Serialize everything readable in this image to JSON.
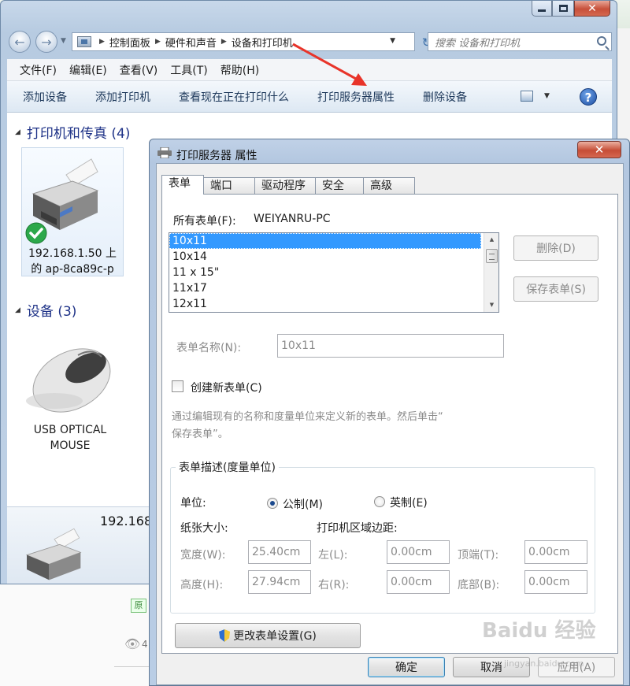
{
  "explorer": {
    "crumbs": [
      "控制面板",
      "硬件和声音",
      "设备和打印机"
    ],
    "search_placeholder": "搜索 设备和打印机",
    "menu": [
      "文件(F)",
      "编辑(E)",
      "查看(V)",
      "工具(T)",
      "帮助(H)"
    ],
    "commands": [
      "添加设备",
      "添加打印机",
      "查看现在正在打印什么",
      "打印服务器属性",
      "删除设备"
    ],
    "group_printers": "打印机和传真 (4)",
    "group_devices": "设备 (3)",
    "printer_label": [
      "192.168.1.50 上",
      "的 ap-8ca89c-p"
    ],
    "mouse_label": [
      "USB OPTICAL",
      "MOUSE"
    ],
    "detail_name": "192.168"
  },
  "dialog": {
    "title": "打印服务器 属性",
    "close_label": "✕",
    "tabs": [
      "表单",
      "端口",
      "驱动程序",
      "安全",
      "高级"
    ],
    "all_forms_label": "所有表单(F):",
    "server_name": "WEIYANRU-PC",
    "forms": [
      "10x11",
      "10x14",
      "11 x 15\"",
      "11x17",
      "12x11"
    ],
    "delete_button": "删除(D)",
    "save_form_button": "保存表单(S)",
    "form_name_label": "表单名称(N):",
    "form_name_value": "10x11",
    "create_new_form": "创建新表单(C)",
    "help_text": [
      "通过编辑现有的名称和度量单位来定义新的表单。然后单击“",
      "保存表单”。"
    ],
    "desc_group_title": "表单描述(度量单位)",
    "units_label": "单位:",
    "metric_label": "公制(M)",
    "imperial_label": "英制(E)",
    "selected_unit": "metric",
    "paper_size_label": "纸张大小:",
    "margins_label": "打印机区域边距:",
    "width_label": "宽度(W):",
    "width_value": "25.40cm",
    "height_label": "高度(H):",
    "height_value": "27.94cm",
    "left_label": "左(L):",
    "left_value": "0.00cm",
    "right_label": "右(R):",
    "right_value": "0.00cm",
    "top_label": "顶端(T):",
    "top_value": "0.00cm",
    "bottom_label": "底部(B):",
    "bottom_value": "0.00cm",
    "change_settings_button": "更改表单设置(G)",
    "ok_button": "确定",
    "cancel_button": "取消",
    "apply_button": "应用(A)"
  },
  "background": {
    "chip_label": "原",
    "view_count": "4",
    "watermark": "Baidu 经验",
    "watermark_sub": "jingyan.baidu.com"
  },
  "colors": {
    "selection": "#3399ff",
    "annotation_arrow": "#e8342a",
    "link_text": "#1e3287"
  }
}
